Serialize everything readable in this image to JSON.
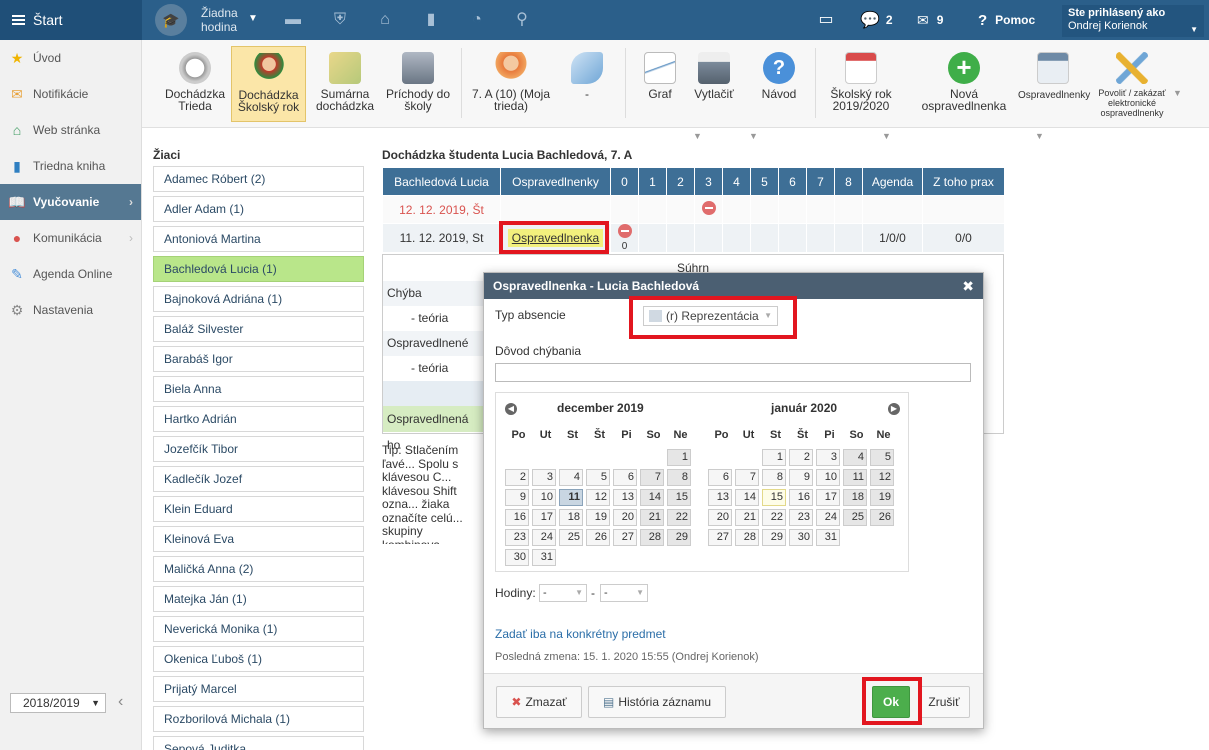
{
  "topbar": {
    "start_label": "Štart",
    "lesson_label": "Žiadna hodina",
    "messages_count": "2",
    "mail_count": "9",
    "help_label": "Pomoc",
    "user_caption": "Ste prihlásený ako",
    "user_name": "Ondrej Korienok"
  },
  "sidebar": {
    "items": [
      {
        "label": "Úvod",
        "icon": "star-icon"
      },
      {
        "label": "Notifikácie",
        "icon": "mail-icon"
      },
      {
        "label": "Web stránka",
        "icon": "home-icon"
      },
      {
        "label": "Triedna kniha",
        "icon": "book-icon"
      },
      {
        "label": "Vyučovanie",
        "icon": "open-book-icon",
        "active": true
      },
      {
        "label": "Komunikácia",
        "icon": "chat-icon"
      },
      {
        "label": "Agenda Online",
        "icon": "pen-icon"
      },
      {
        "label": "Nastavenia",
        "icon": "gear-icon"
      }
    ],
    "year": "2018/2019"
  },
  "toolbar": {
    "dochadzka_trieda": "Dochádzka Trieda",
    "dochadzka_skolsky_rok": "Dochádzka Školský rok",
    "sumarna": "Sumárna dochádzka",
    "prichody": "Príchody do školy",
    "trieda": "7. A (10) (Moja trieda)",
    "dash": "-",
    "graf": "Graf",
    "vytlacit": "Vytlačiť",
    "navod": "Návod",
    "skolsky_rok": "Školský rok 2019/2020",
    "nova": "Nová ospravedlnenka",
    "ospravedlnenky": "Ospravedlnenky",
    "povolit": "Povoliť / zakázať elektronické ospravedlnenky"
  },
  "students": {
    "title": "Žiaci",
    "items": [
      "Adamec Róbert (2)",
      "Adler Adam (1)",
      "Antoniová Martina",
      "Bachledová Lucia (1)",
      "Bajnoková Adriána (1)",
      "Baláž Silvester",
      "Barabáš Igor",
      "Biela Anna",
      "Hartko Adrián",
      "Jozefčík Tibor",
      "Kadlečík Jozef",
      "Klein Eduard",
      "Kleinová Eva",
      "Maličká Anna (2)",
      "Matejka Ján (1)",
      "Neverická Monika (1)",
      "Okenica Ľuboš (1)",
      "Prijatý Marcel",
      "Rozborilová Michala (1)",
      "Sepová Juditka"
    ],
    "active_index": 3
  },
  "attendance": {
    "title": "Dochádzka študenta Lucia Bachledová, 7. A",
    "headers": [
      "Bachledová Lucia",
      "Ospravedlnenky",
      "0",
      "1",
      "2",
      "3",
      "4",
      "5",
      "6",
      "7",
      "8",
      "Agenda",
      "Z toho prax"
    ],
    "row1_date": "12. 12. 2019, Št",
    "row2_date": "11. 12. 2019, St",
    "row2_link": "Ospravedlnenka",
    "row2_zero": "0",
    "row2_agenda": "1/0/0",
    "row2_prax": "0/0",
    "summary_title": "Súhrn",
    "chyba": "Chýba",
    "teoria1": "- teória",
    "ospravedlnene": "Ospravedlnené",
    "teoria2": "- teória",
    "ospravedlnena_ho": "Ospravedlnená ho",
    "tip": "Tip: Stlačením ľavé... Spolu s klávesou C... klávesou Shift ozna... žiaka označíte celú... skupiny kombinova... Stlačením pravého... chýbanie študenta ..."
  },
  "dialog": {
    "title": "Ospravedlnenka - Lucia Bachledová",
    "typ_label": "Typ absencie",
    "typ_value": "(r) Reprezentácia",
    "dovod_label": "Dôvod chýbania",
    "month1": "december 2019",
    "month2": "január 2020",
    "dow": [
      "Po",
      "Ut",
      "St",
      "Št",
      "Pi",
      "So",
      "Ne"
    ],
    "hodiny_label": "Hodiny:",
    "hod_from": "-",
    "hod_sep": "-",
    "hod_to": "-",
    "link_predmet": "Zadať iba na konkrétny predmet",
    "last_change": "Posledná zmena: 15. 1. 2020 15:55 (Ondrej Korienok)",
    "btn_delete": "Zmazať",
    "btn_history": "História záznamu",
    "btn_ok": "Ok",
    "btn_cancel": "Zrušiť"
  },
  "colors": {
    "topbar": "#2b5f8a",
    "table_header": "#3e6f96",
    "active_student": "#b9e68a",
    "ok_button": "#4cae4c",
    "highlight_box": "#e2161f"
  }
}
